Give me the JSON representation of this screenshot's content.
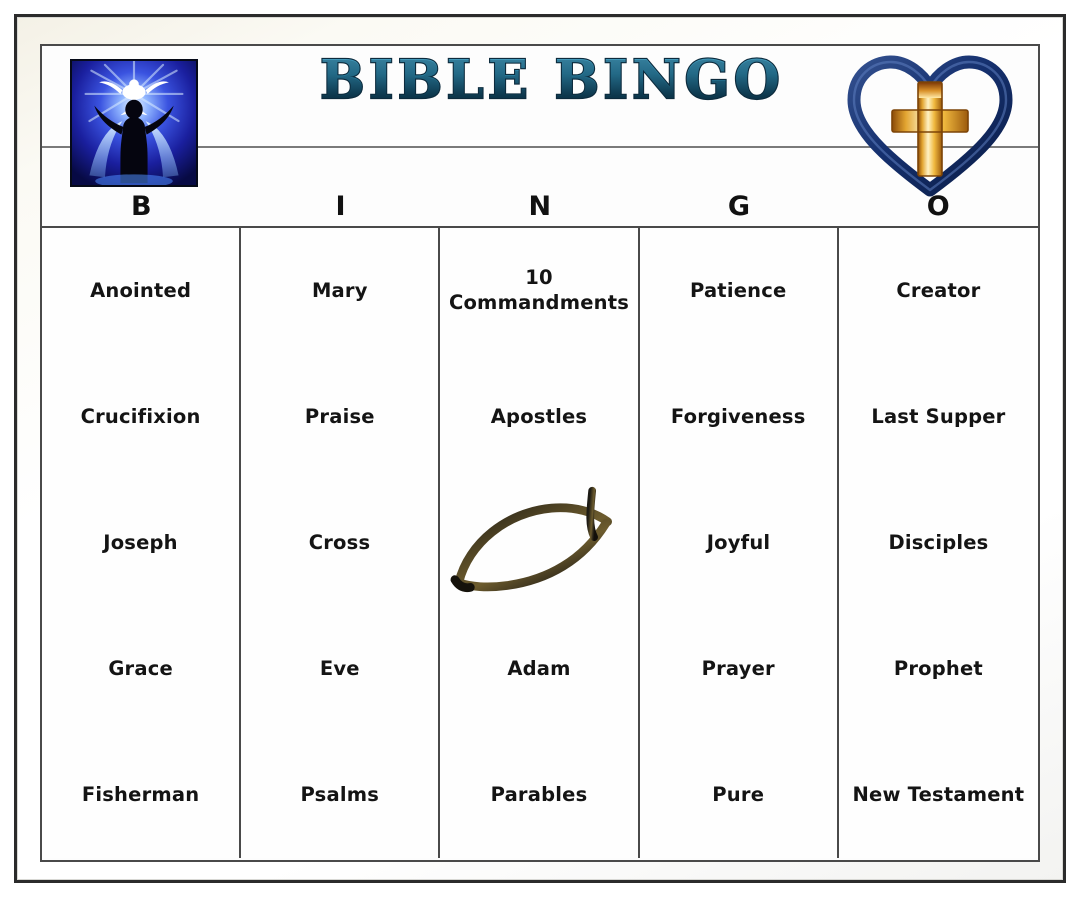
{
  "card": {
    "title": "BIBLE BINGO",
    "title_color": "#2b7f9f",
    "title_outline_color": "#0d2b3d",
    "frame_color": "#2b2b2b",
    "grid_line_color": "#4a4a4a",
    "cell_text_color": "#141414",
    "background_color": "#ffffff"
  },
  "logos": {
    "left": {
      "name": "dove-worship-image",
      "description": "White dove above black silhouette of worshipper with raised arms on blue radiant background",
      "colors": {
        "background": "#1b23b4",
        "glow": "#cfe6ff",
        "silhouette": "#05050f"
      }
    },
    "right": {
      "name": "heart-cross-logo",
      "description": "Navy blue heart outline containing a golden cross",
      "colors": {
        "heart": "#16306e",
        "cross_light": "#ffe9a8",
        "cross_mid": "#e8a52a",
        "cross_dark": "#8a4a08"
      }
    }
  },
  "columns": [
    {
      "letter": "B"
    },
    {
      "letter": "I"
    },
    {
      "letter": "N"
    },
    {
      "letter": "G"
    },
    {
      "letter": "O"
    }
  ],
  "grid": [
    [
      {
        "text": "Anointed",
        "type": "text"
      },
      {
        "text": "Mary",
        "type": "text"
      },
      {
        "text": "10\nCommandments",
        "type": "text"
      },
      {
        "text": "Patience",
        "type": "text"
      },
      {
        "text": "Creator",
        "type": "text"
      }
    ],
    [
      {
        "text": "Crucifixion",
        "type": "text"
      },
      {
        "text": "Praise",
        "type": "text"
      },
      {
        "text": "Apostles",
        "type": "text"
      },
      {
        "text": "Forgiveness",
        "type": "text"
      },
      {
        "text": "Last Supper",
        "type": "text"
      }
    ],
    [
      {
        "text": "Joseph",
        "type": "text"
      },
      {
        "text": "Cross",
        "type": "text"
      },
      {
        "text": "",
        "type": "free-space-fish",
        "icon": "ichthys-fish-icon"
      },
      {
        "text": "Joyful",
        "type": "text"
      },
      {
        "text": "Disciples",
        "type": "text"
      }
    ],
    [
      {
        "text": "Grace",
        "type": "text"
      },
      {
        "text": "Eve",
        "type": "text"
      },
      {
        "text": "Adam",
        "type": "text"
      },
      {
        "text": "Prayer",
        "type": "text"
      },
      {
        "text": "Prophet",
        "type": "text"
      }
    ],
    [
      {
        "text": "Fisherman",
        "type": "text"
      },
      {
        "text": "Psalms",
        "type": "text"
      },
      {
        "text": "Parables",
        "type": "text"
      },
      {
        "text": "Pure",
        "type": "text"
      },
      {
        "text": "New Testament",
        "type": "text"
      }
    ]
  ]
}
